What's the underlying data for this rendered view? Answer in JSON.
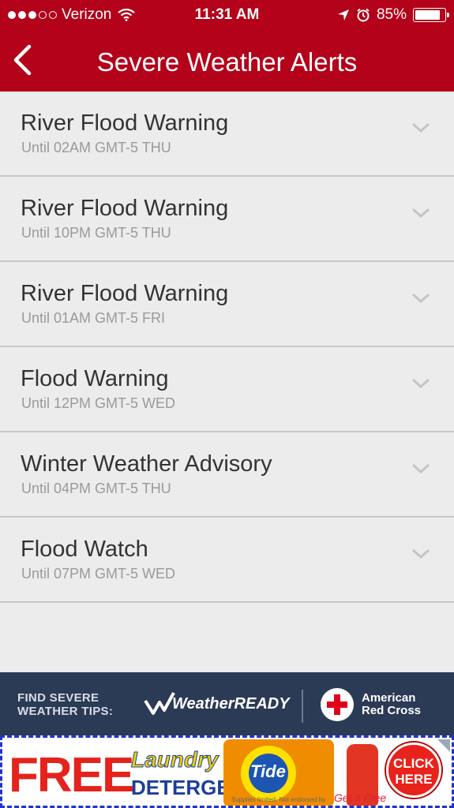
{
  "status_bar": {
    "carrier": "Verizon",
    "time": "11:31 AM",
    "battery": "85%",
    "battery_level": 0.85,
    "signal_bars_filled": 3,
    "signal_bars_total": 5
  },
  "nav": {
    "title": "Severe Weather Alerts",
    "back_icon": "chevron-left-icon"
  },
  "alerts": [
    {
      "name": "River Flood Warning",
      "until": "Until 02AM GMT-5 THU"
    },
    {
      "name": "River Flood Warning",
      "until": "Until 10PM GMT-5 THU"
    },
    {
      "name": "River Flood Warning",
      "until": "Until 01AM GMT-5 FRI"
    },
    {
      "name": "Flood Warning",
      "until": "Until 12PM GMT-5 WED"
    },
    {
      "name": "Winter Weather Advisory",
      "until": "Until 04PM GMT-5 THU"
    },
    {
      "name": "Flood Watch",
      "until": "Until 07PM GMT-5 WED"
    }
  ],
  "banner": {
    "tips_line1": "FIND SEVERE",
    "tips_line2": "WEATHER TIPS:",
    "weather_ready": "WeatherREADY",
    "red_cross_line1": "American",
    "red_cross_line2": "Red Cross"
  },
  "ad": {
    "free": "FREE",
    "laundry": "Laundry",
    "detergent": "DETERGENT",
    "brand": "Tide",
    "click_line1": "CLICK",
    "click_line2": "HERE",
    "get_free": "Get it Free",
    "fine_print": "Supplies limited. Not endorsed by"
  },
  "colors": {
    "brand_red": "#b3021a",
    "banner_navy": "#2b3a55",
    "list_bg": "#ececec"
  }
}
